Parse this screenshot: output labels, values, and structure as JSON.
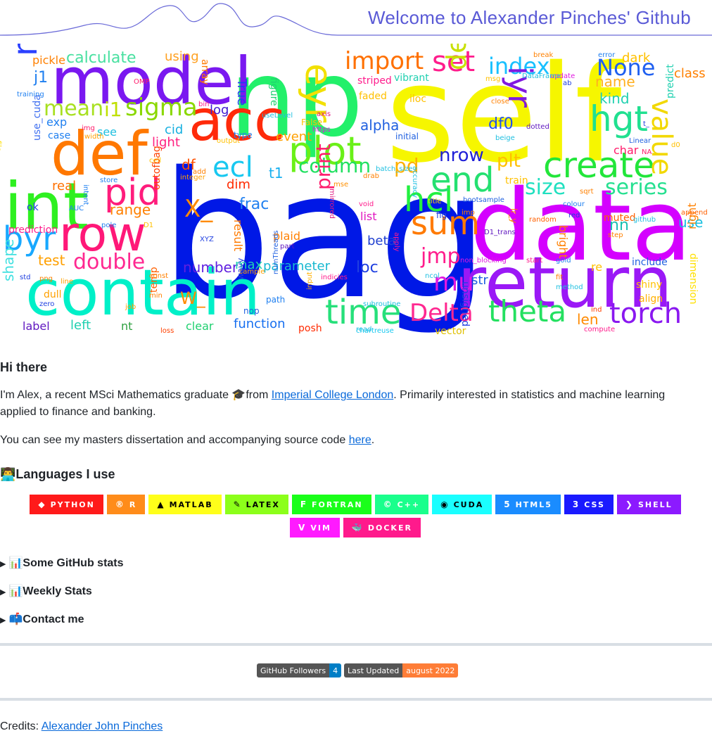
{
  "header": {
    "title": "Welcome to Alexander Pinches' Github"
  },
  "wordcloud": [
    {
      "t": "self",
      "c": "#f6f600"
    },
    {
      "t": "bag",
      "c": "#0018e6"
    },
    {
      "t": "data",
      "c": "#d400ff"
    },
    {
      "t": "np",
      "c": "#22f06a"
    },
    {
      "t": "model",
      "c": "#7a18f0"
    },
    {
      "t": "contain",
      "c": "#00f0c8"
    },
    {
      "t": "return",
      "c": "#9a18f6"
    },
    {
      "t": "int",
      "c": "#2ef020"
    },
    {
      "t": "def",
      "c": "#ff7800"
    },
    {
      "t": "acc",
      "c": "#ff2a0a"
    },
    {
      "t": "row",
      "c": "#ff1878"
    },
    {
      "t": "byr",
      "c": "#18a8ff"
    },
    {
      "t": "create",
      "c": "#22e63a"
    },
    {
      "t": "plot",
      "c": "#6af018"
    },
    {
      "t": "set",
      "c": "#ff1c8c"
    },
    {
      "t": "time",
      "c": "#26e07a"
    },
    {
      "t": "sum",
      "c": "#ff7a00"
    },
    {
      "t": "Delta",
      "c": "#ff2890"
    },
    {
      "t": "theta",
      "c": "#24e060"
    },
    {
      "t": "torch",
      "c": "#8a18f0"
    },
    {
      "t": "value",
      "c": "#f2d800"
    },
    {
      "t": "hcl",
      "c": "#22f040"
    },
    {
      "t": "end",
      "c": "#24e070"
    },
    {
      "t": "matrix",
      "c": "#2a40ff"
    },
    {
      "t": "pid",
      "c": "#ff1c7c"
    },
    {
      "t": "hgt",
      "c": "#20e090"
    },
    {
      "t": "sigma",
      "c": "#8ad800"
    },
    {
      "t": "index",
      "c": "#18c0ff"
    },
    {
      "t": "import",
      "c": "#ff7000"
    },
    {
      "t": "eyr",
      "c": "#f2e000"
    },
    {
      "t": "ecl",
      "c": "#18c8f0"
    },
    {
      "t": "mean",
      "c": "#a8e020"
    },
    {
      "t": "iyr",
      "c": "#8018e0"
    },
    {
      "t": "None",
      "c": "#2060f0"
    },
    {
      "t": "device",
      "c": "#c8e000"
    },
    {
      "t": "size",
      "c": "#20e0c0"
    },
    {
      "t": "series",
      "c": "#26e090"
    },
    {
      "t": "column",
      "c": "#20e060"
    },
    {
      "t": "double",
      "c": "#ff2890"
    },
    {
      "t": "mu",
      "c": "#e018e0"
    },
    {
      "t": "jmp",
      "c": "#ff1c8c"
    },
    {
      "t": "print",
      "c": "#ff1c6c"
    },
    {
      "t": "X_",
      "c": "#ff8a00"
    },
    {
      "t": "pd",
      "c": "#ffb000"
    },
    {
      "t": "plt",
      "c": "#ffc000"
    },
    {
      "t": "nrow",
      "c": "#2020d8"
    },
    {
      "t": "test",
      "c": "#ffa000"
    },
    {
      "t": "shape",
      "c": "#40e0e0"
    },
    {
      "t": "alpha",
      "c": "#2060e0"
    },
    {
      "t": "kind",
      "c": "#20d0b0"
    },
    {
      "t": "name",
      "c": "#ffb020"
    },
    {
      "t": "class",
      "c": "#ff8000"
    },
    {
      "t": "calculate",
      "c": "#48e0a0"
    },
    {
      "t": "df0",
      "c": "#2050f0"
    },
    {
      "t": "loc",
      "c": "#2040e0"
    },
    {
      "t": "range",
      "c": "#ff8000"
    },
    {
      "t": "frac",
      "c": "#2080f0"
    },
    {
      "t": "parameter",
      "c": "#18b8d0"
    },
    {
      "t": "number",
      "c": "#6020e0"
    },
    {
      "t": "function",
      "c": "#1870f0"
    },
    {
      "t": "label",
      "c": "#6018c0"
    },
    {
      "t": "left",
      "c": "#20d0b0"
    },
    {
      "t": "W_",
      "c": "#ff8a00"
    },
    {
      "t": "len",
      "c": "#ff8a00"
    },
    {
      "t": "nn",
      "c": "#18c0b0"
    },
    {
      "t": "use",
      "c": "#18c0e0"
    },
    {
      "t": "str",
      "c": "#2060e0"
    },
    {
      "t": "beta",
      "c": "#2040d0"
    },
    {
      "t": "max",
      "c": "#20d0b0"
    },
    {
      "t": "real",
      "c": "#ff7000"
    },
    {
      "t": "dim",
      "c": "#ff2a00"
    },
    {
      "t": "exp",
      "c": "#2080f0"
    },
    {
      "t": "log",
      "c": "#4018d0"
    },
    {
      "t": "array",
      "c": "#ff7a00"
    },
    {
      "t": "True",
      "c": "#2040f0"
    },
    {
      "t": "using",
      "c": "#ffa020"
    },
    {
      "t": "pickle",
      "c": "#ff8000"
    },
    {
      "t": "j1",
      "c": "#2080f0"
    },
    {
      "t": "i1",
      "c": "#c0e000"
    },
    {
      "t": "see",
      "c": "#20c0e0"
    },
    {
      "t": "cid",
      "c": "#18b0e0"
    },
    {
      "t": "light",
      "c": "#ff2080"
    },
    {
      "t": "df",
      "c": "#ff5000"
    },
    {
      "t": "t1",
      "c": "#18b0f0"
    },
    {
      "t": "event",
      "c": "#ffa000"
    },
    {
      "t": "ok",
      "c": "#2040e0"
    },
    {
      "t": "prediction",
      "c": "#ff1c8c"
    },
    {
      "t": "clear",
      "c": "#20d070"
    },
    {
      "t": "nt",
      "c": "#2ea040"
    },
    {
      "t": "temp",
      "c": "#ff6000"
    },
    {
      "t": "list",
      "c": "#e018c0"
    },
    {
      "t": "result",
      "c": "#ff7a00"
    },
    {
      "t": "train",
      "c": "#ffc000"
    },
    {
      "t": "mse",
      "c": "#ff9000"
    },
    {
      "t": "bright",
      "c": "#ff8000"
    },
    {
      "t": "right",
      "c": "#ff8000"
    },
    {
      "t": "shiny",
      "c": "#ffc000"
    },
    {
      "t": "align",
      "c": "#ffb000"
    },
    {
      "t": "include",
      "c": "#2060e0"
    },
    {
      "t": "muted",
      "c": "#ff6000"
    },
    {
      "t": "re",
      "c": "#ffc000"
    },
    {
      "t": "dark",
      "c": "#ffc000"
    },
    {
      "t": "predict",
      "c": "#20d0b0"
    },
    {
      "t": "dimension",
      "c": "#ffe000"
    },
    {
      "t": "posh",
      "c": "#ff2a00"
    },
    {
      "t": "vector",
      "c": "#e0c000"
    },
    {
      "t": "unsigned",
      "c": "#2040e0"
    },
    {
      "t": "dull",
      "c": "#ffa000"
    },
    {
      "t": "plaid",
      "c": "#ff8000"
    },
    {
      "t": "outofbag",
      "c": "#ff4000"
    },
    {
      "t": "use_cuda",
      "c": "#4070f0"
    },
    {
      "t": "file",
      "c": "#ffe000"
    },
    {
      "t": "case",
      "c": "#2080f0"
    },
    {
      "t": "mirrored",
      "c": "#e01880"
    },
    {
      "t": "path",
      "c": "#2080f0"
    },
    {
      "t": "nop",
      "c": "#2060e0"
    },
    {
      "t": "job",
      "c": "#ffa000"
    },
    {
      "t": "training",
      "c": "#2080f0"
    },
    {
      "t": "striped",
      "c": "#ff1c8c"
    },
    {
      "t": "vibrant",
      "c": "#20d0b0"
    },
    {
      "t": "iloc",
      "c": "#ffc000"
    },
    {
      "t": "faded",
      "c": "#ffc000"
    },
    {
      "t": "figure",
      "c": "#20d070"
    },
    {
      "t": "break",
      "c": "#ff8000"
    },
    {
      "t": "error",
      "c": "#2080f0"
    },
    {
      "t": "update",
      "c": "#e018e0"
    },
    {
      "t": "close",
      "c": "#ff8000"
    },
    {
      "t": "axis",
      "c": "#e01880"
    },
    {
      "t": "False",
      "c": "#ffc000"
    },
    {
      "t": "https",
      "c": "#e018e0"
    },
    {
      "t": "type",
      "c": "#2080f0"
    },
    {
      "t": "store",
      "c": "#2080f0"
    },
    {
      "t": "integer",
      "c": "#ffa000"
    },
    {
      "t": "void",
      "c": "#ff1c8c"
    },
    {
      "t": "title",
      "c": "#ffe000"
    },
    {
      "t": "fig",
      "c": "#2040e0"
    },
    {
      "t": "dotted",
      "c": "#6018c0"
    },
    {
      "t": "beige",
      "c": "#20c0e0"
    },
    {
      "t": "char",
      "c": "#ff1c6c"
    },
    {
      "t": "Linear",
      "c": "#2060e0"
    },
    {
      "t": "random",
      "c": "#ff6000"
    },
    {
      "t": "red",
      "c": "#2040e0"
    },
    {
      "t": "step",
      "c": "#ff8000"
    },
    {
      "t": "fit",
      "c": "#ff7a00"
    },
    {
      "t": "method",
      "c": "#20c0e0"
    },
    {
      "t": "ind",
      "c": "#ff4000"
    },
    {
      "t": "compute",
      "c": "#ff1c8c"
    },
    {
      "t": "start",
      "c": "#ff1c8c"
    },
    {
      "t": "gold",
      "c": "#2080f0"
    },
    {
      "t": "sqrt",
      "c": "#ff8000"
    },
    {
      "t": "colour",
      "c": "#2080f0"
    },
    {
      "t": "append",
      "c": "#ff6000"
    },
    {
      "t": "bootsample",
      "c": "#2060e0"
    },
    {
      "t": "imp",
      "c": "#ff8000"
    },
    {
      "t": "non_blocking",
      "c": "#e018e0"
    },
    {
      "t": "accuracy",
      "c": "#20c0e0"
    },
    {
      "t": "ncol",
      "c": "#20c0e0"
    },
    {
      "t": "apply",
      "c": "#ff1c8c"
    },
    {
      "t": "subroutine",
      "c": "#20c0e0"
    },
    {
      "t": "chartreuse",
      "c": "#18c8f0"
    },
    {
      "t": "read",
      "c": "#20c0e0"
    },
    {
      "t": "indicies",
      "c": "#ff1c8c"
    },
    {
      "t": "XYZ",
      "c": "#2040e0"
    },
    {
      "t": "sample",
      "c": "#ffa000"
    },
    {
      "t": "wavy",
      "c": "#2040e0"
    },
    {
      "t": "numThreads",
      "c": "#2060e0"
    },
    {
      "t": "input",
      "c": "#ffb000"
    },
    {
      "t": "min",
      "c": "#ff8000"
    },
    {
      "t": "loss",
      "c": "#ff4000"
    },
    {
      "t": "const",
      "c": "#ff8000"
    },
    {
      "t": "pole",
      "c": "#2080f0"
    },
    {
      "t": "intent",
      "c": "#2080f0"
    },
    {
      "t": "AUC",
      "c": "#2080f0"
    },
    {
      "t": "png",
      "c": "#ff8000"
    },
    {
      "t": "line",
      "c": "#ffa000"
    },
    {
      "t": "std",
      "c": "#2040e0"
    },
    {
      "t": "zero",
      "c": "#2040e0"
    },
    {
      "t": "width",
      "c": "#ffa000"
    },
    {
      "t": "img",
      "c": "#ff1c6c"
    },
    {
      "t": "OMP",
      "c": "#ff1c6c"
    },
    {
      "t": "bin",
      "c": "#ff1c8c"
    },
    {
      "t": "useLevel",
      "c": "#20c0e0"
    },
    {
      "t": "output",
      "c": "#ffc000"
    },
    {
      "t": "add",
      "c": "#ff8000"
    },
    {
      "t": "cell",
      "c": "#ffc000"
    },
    {
      "t": "msg",
      "c": "#ffc000"
    },
    {
      "t": "DataFrame",
      "c": "#20c0e0"
    },
    {
      "t": "ab",
      "c": "#2040e0"
    },
    {
      "t": "t_",
      "c": "#2040e0"
    },
    {
      "t": "NA",
      "c": "#ff1c6c"
    },
    {
      "t": "d0",
      "c": "#ffc000"
    },
    {
      "t": "github",
      "c": "#20c0e0"
    },
    {
      "t": "D1_trans",
      "c": "#6018c0"
    },
    {
      "t": "lr_y",
      "c": "#ff8000"
    },
    {
      "t": "batch_size",
      "c": "#20c0e0"
    },
    {
      "t": "drab",
      "c": "#ff8000"
    },
    {
      "t": "initial",
      "c": "#2060e0"
    },
    {
      "t": "part",
      "c": "#6018c0"
    },
    {
      "t": "D1",
      "c": "#ffc000"
    },
    {
      "t": "dx",
      "c": "#2060e0"
    }
  ],
  "intro": {
    "heading": "Hi there",
    "p1_before": "I'm Alex, a recent MSci Mathematics graduate ",
    "p1_emoji": "🎓",
    "p1_mid": "from ",
    "p1_link": "Imperial College London",
    "p1_after": ". Primarily interested in statistics and machine learning applied to finance and banking.",
    "p2_before": "You can see my masters dissertation and accompanying source code ",
    "p2_link": "here",
    "p2_after": "."
  },
  "languages": {
    "heading_emoji": "👨‍💻",
    "heading": "Languages I use",
    "badges": [
      {
        "label": "PYTHON",
        "icon": "python-icon",
        "glyph": "◆",
        "bg": "#ff1a1a",
        "fg": "#ffffff"
      },
      {
        "label": "R",
        "icon": "r-icon",
        "glyph": "®",
        "bg": "#ff8c1a",
        "fg": "#ffffff"
      },
      {
        "label": "MATLAB",
        "icon": "matlab-icon",
        "glyph": "▲",
        "bg": "#ffff1a",
        "fg": "#000000"
      },
      {
        "label": "LATEX",
        "icon": "latex-icon",
        "glyph": "✎",
        "bg": "#8cff1a",
        "fg": "#000000"
      },
      {
        "label": "FORTRAN",
        "icon": "fortran-icon",
        "glyph": "F",
        "bg": "#1aff1a",
        "fg": "#ffffff"
      },
      {
        "label": "C++",
        "icon": "cpp-icon",
        "glyph": "©",
        "bg": "#1aff8c",
        "fg": "#ffffff"
      },
      {
        "label": "CUDA",
        "icon": "cuda-icon",
        "glyph": "◉",
        "bg": "#1affff",
        "fg": "#000000"
      },
      {
        "label": "HTML5",
        "icon": "html5-icon",
        "glyph": "5",
        "bg": "#1a8cff",
        "fg": "#ffffff"
      },
      {
        "label": "CSS",
        "icon": "css-icon",
        "glyph": "3",
        "bg": "#1a1aff",
        "fg": "#ffffff"
      },
      {
        "label": "SHELL",
        "icon": "shell-icon",
        "glyph": "❯",
        "bg": "#8c1aff",
        "fg": "#ffffff"
      },
      {
        "label": "VIM",
        "icon": "vim-icon",
        "glyph": "V",
        "bg": "#ff1aff",
        "fg": "#ffffff"
      },
      {
        "label": "DOCKER",
        "icon": "docker-icon",
        "glyph": "🐳",
        "bg": "#ff1a8c",
        "fg": "#ffffff"
      }
    ]
  },
  "details": [
    {
      "emoji": "📊",
      "label": "Some GitHub stats"
    },
    {
      "emoji": "📊",
      "label": "Weekly Stats"
    },
    {
      "emoji": "📫",
      "label": "Contact me"
    }
  ],
  "shields": {
    "followers_label": "GitHub Followers",
    "followers_value": "4",
    "followers_color": "#007ec6",
    "updated_label": "Last Updated",
    "updated_value": "august 2022",
    "updated_color": "#fe7d37"
  },
  "credits": {
    "label": "Credits: ",
    "link": "Alexander John Pinches"
  }
}
